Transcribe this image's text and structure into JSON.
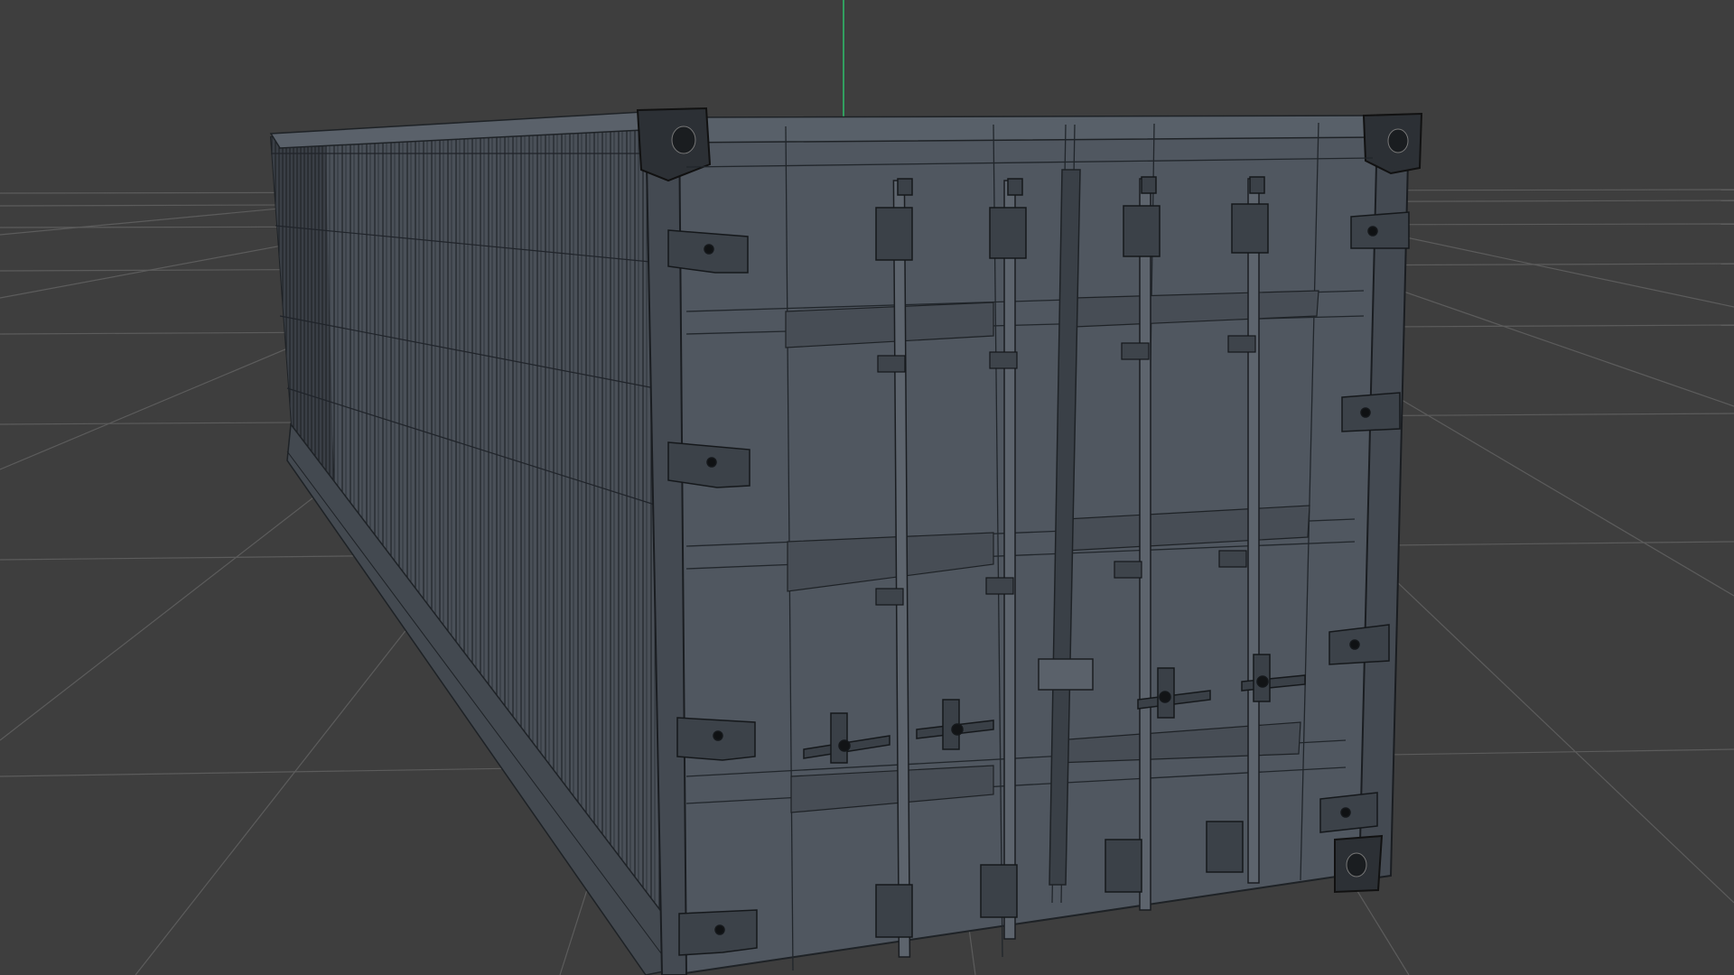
{
  "viewport": {
    "background": "#3e3e3e",
    "grid_color": "#5c5c5c",
    "axis_y_color": "#2fbf6a"
  },
  "model": {
    "object": "shipping-container",
    "display_mode": "wireframe-on-shaded",
    "shaded_color": "#4f5660",
    "wire_color": "#1e2226",
    "highlight_color": "#6c737c"
  }
}
